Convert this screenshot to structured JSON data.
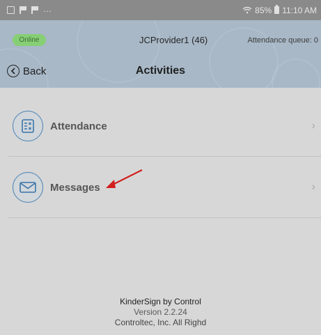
{
  "status_bar": {
    "dots": "...",
    "battery": "85%",
    "time": "11:10 AM"
  },
  "header": {
    "online_badge": "Online",
    "provider": "JCProvider1 (46)",
    "attendance_queue": "Attendance queue: 0",
    "back_label": "Back",
    "title": "Activities"
  },
  "activities": [
    {
      "label": "Attendance",
      "icon": "attendance-checklist-icon"
    },
    {
      "label": "Messages",
      "icon": "envelope-icon"
    }
  ],
  "footer": {
    "app_name": "KinderSign by Control",
    "version": "Version 2.2.24",
    "copyright": "Controltec, Inc. All Righd"
  },
  "colors": {
    "header_bg": "#a8b8c7",
    "online_badge": "#86cf74",
    "icon_ring": "#4a81b3",
    "annotation_arrow": "#d21f1f"
  }
}
